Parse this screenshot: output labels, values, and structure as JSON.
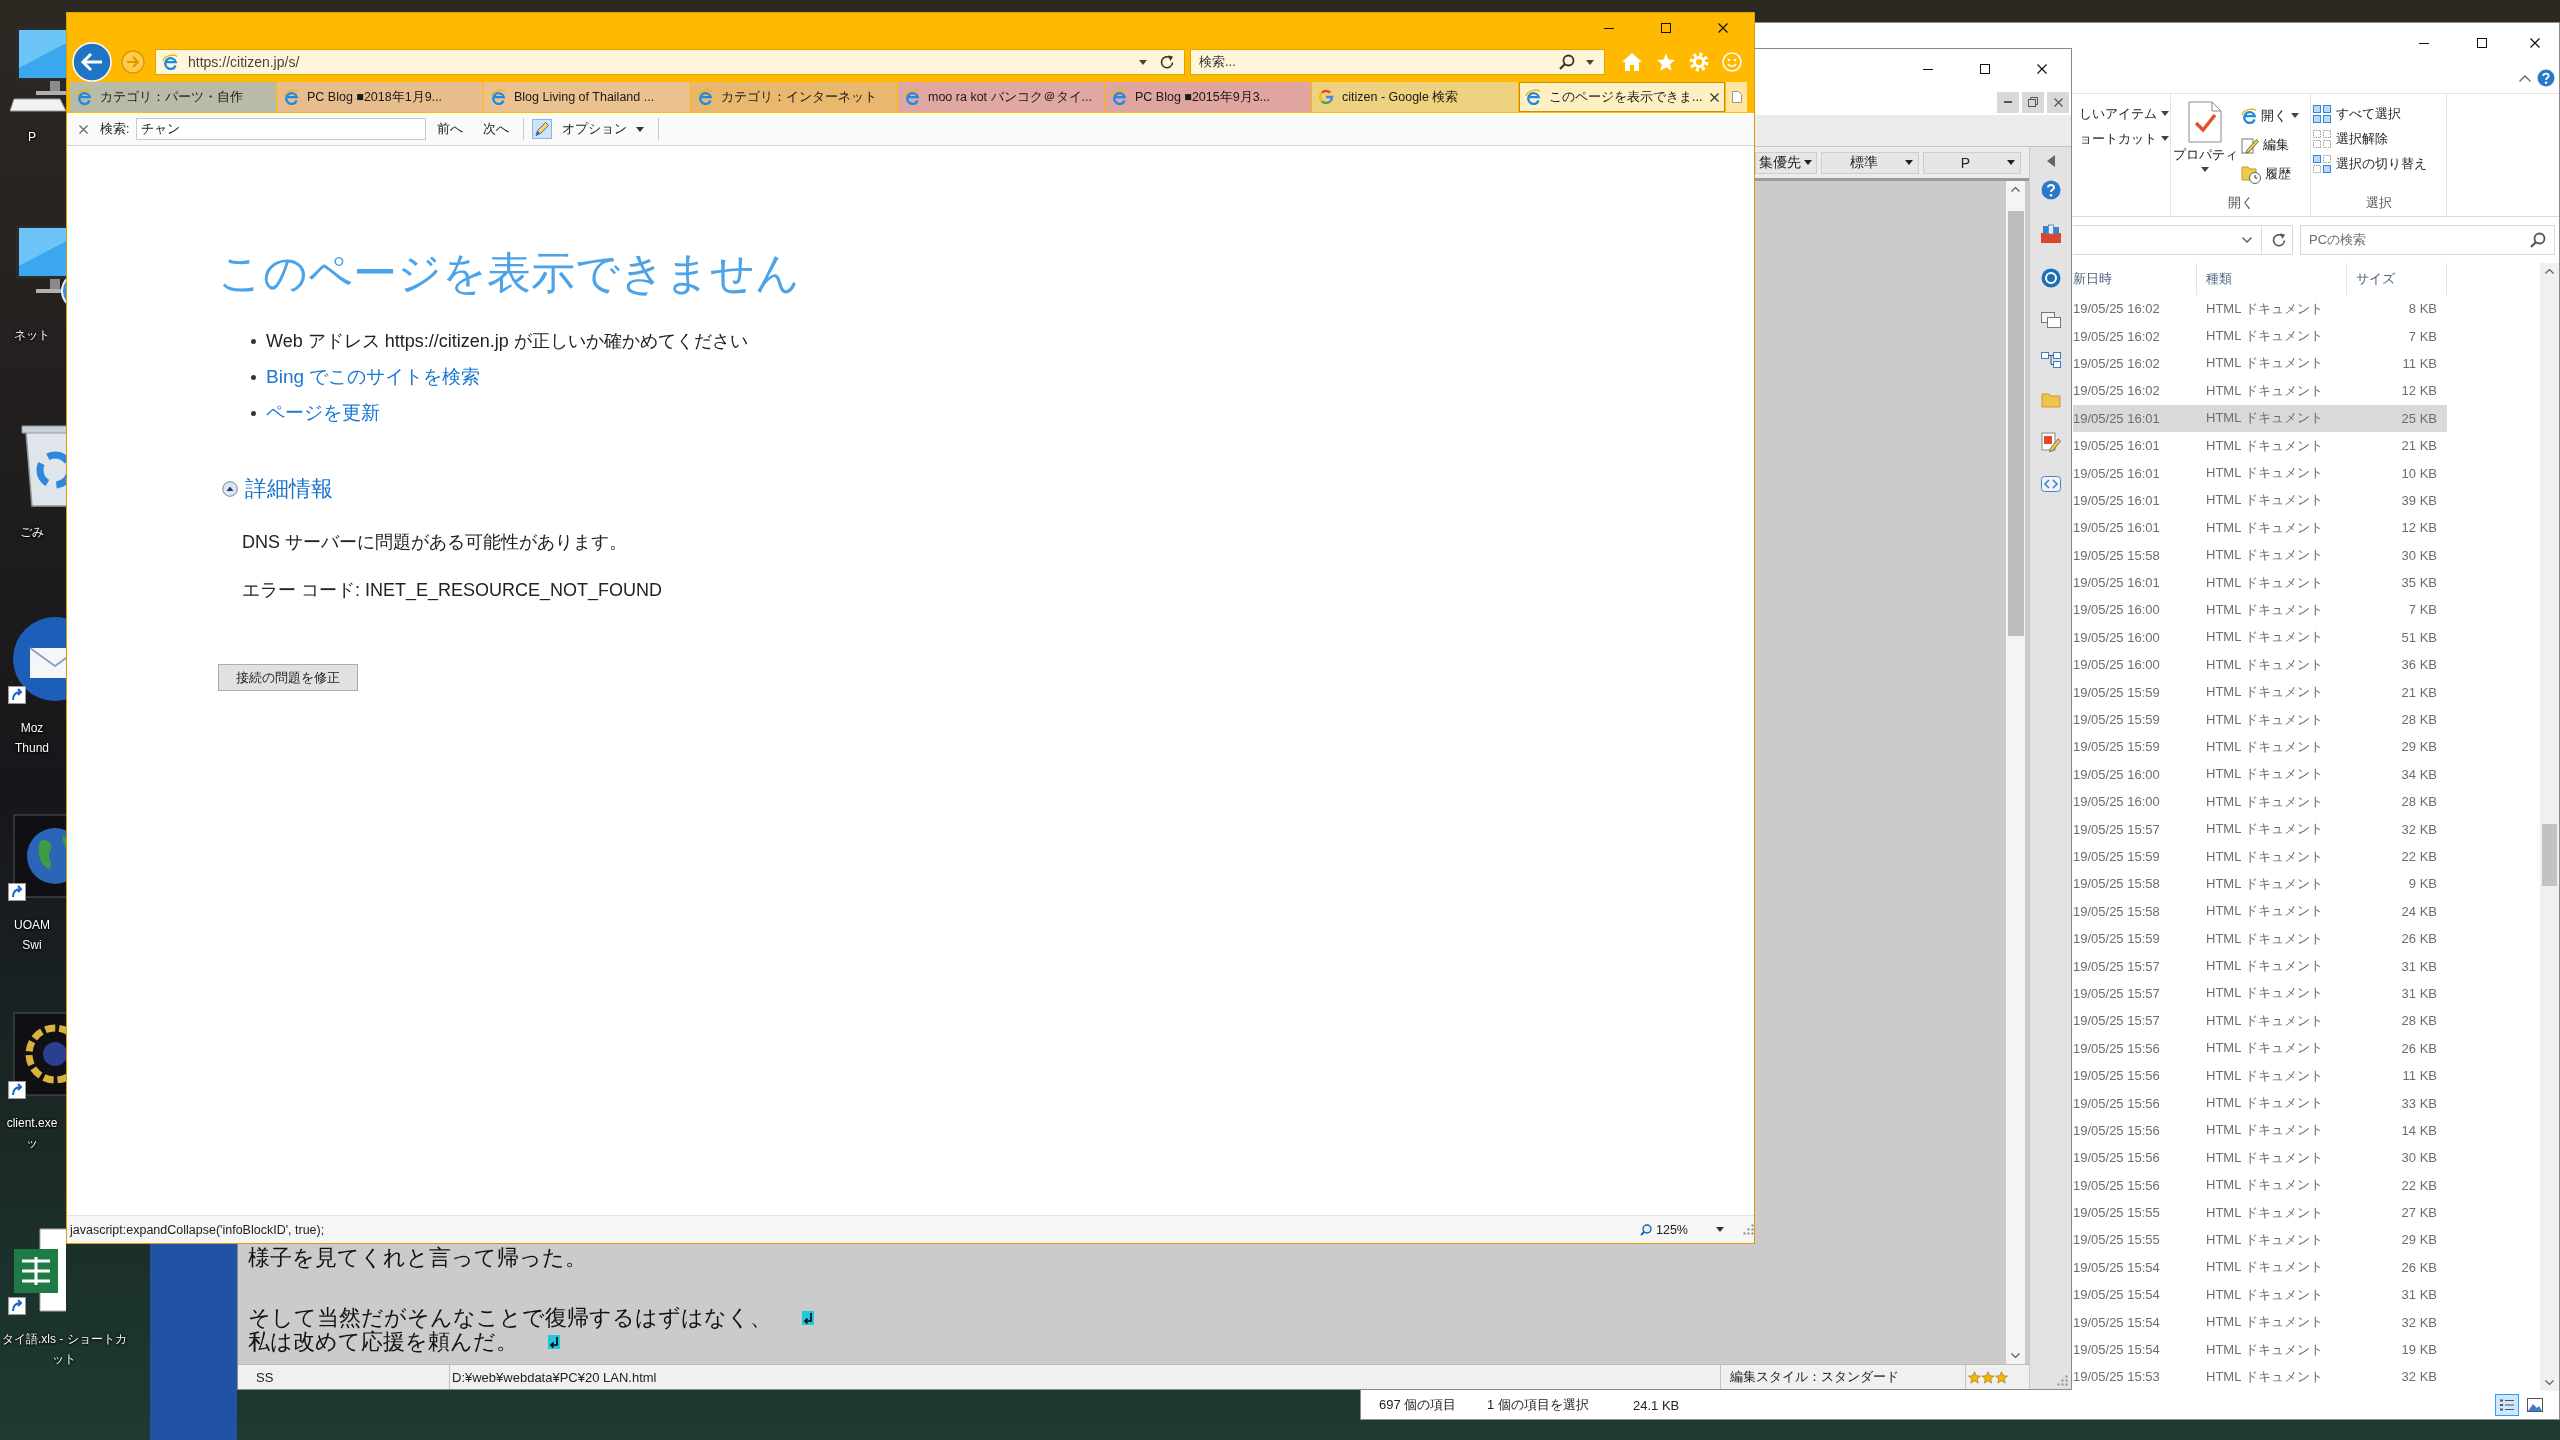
{
  "desktop": {
    "icons": [
      {
        "kind": "pc",
        "label": [
          "P"
        ],
        "shortcut": false
      },
      {
        "kind": "network",
        "label": [
          "ネット"
        ],
        "shortcut": false
      },
      {
        "kind": "trash",
        "label": [
          "ごみ"
        ],
        "shortcut": false
      },
      {
        "kind": "mail",
        "label": [
          "Moz",
          "Thund"
        ],
        "shortcut": true
      },
      {
        "kind": "globe",
        "label": [
          "UOAM",
          "Swi"
        ],
        "shortcut": true
      },
      {
        "kind": "ring",
        "label": [
          "client.exe",
          "ッ"
        ],
        "shortcut": true
      },
      {
        "kind": "sheet",
        "label": [
          "タイ語.xls - ショートカ",
          "ット"
        ],
        "shortcut": true
      }
    ]
  },
  "browser": {
    "address": "https://citizen.jp/s/",
    "search": {
      "placeholder": "検索..."
    },
    "tabs": [
      {
        "label": "カテゴリ：パーツ・自作",
        "kind": "page",
        "color": "#b8bca7",
        "selected": false
      },
      {
        "label": "PC Blog ■2018年1月9...",
        "kind": "page",
        "color": "#e8bd8e",
        "selected": false
      },
      {
        "label": "Blog Living of Thailand ...",
        "kind": "page",
        "color": "#ebc28f",
        "selected": false
      },
      {
        "label": "カテゴリ：インターネット",
        "kind": "page",
        "color": "#e9b86e",
        "selected": false
      },
      {
        "label": "moo ra kot バンコク＠タイ...",
        "kind": "page",
        "color": "#e1a8a1",
        "selected": false
      },
      {
        "label": "PC Blog ■2015年9月3...",
        "kind": "page",
        "color": "#dfa59e",
        "selected": false
      },
      {
        "label": "citizen - Google 検索",
        "kind": "search",
        "color": "#eed27f",
        "selected": false
      },
      {
        "label": "このページを表示できま...",
        "kind": "page",
        "color": "#fff0c4",
        "selected": true
      }
    ],
    "find_bar": {
      "label": "検索:",
      "value": "チャン",
      "previous": "前へ",
      "next": "次へ",
      "options": "オプション"
    },
    "page": {
      "title": "このページを表示できません",
      "bullets": [
        {
          "kind": "text",
          "text": "Web アドレス https://citizen.jp が正しいか確かめてください"
        },
        {
          "kind": "link",
          "text": "Bing でこのサイトを検索"
        },
        {
          "kind": "link",
          "text": "ページを更新"
        }
      ],
      "details": {
        "label": "詳細情報",
        "expanded": true,
        "lines": [
          "DNS サーバーに問題がある可能性があります。",
          "エラー コード: INET_E_RESOURCE_NOT_FOUND"
        ]
      },
      "fix_button": "接続の問題を修正"
    },
    "status_bar": {
      "link": "javascript:expandCollapse('infoBlockID', true);",
      "zoom": "125%"
    }
  },
  "editor": {
    "toolbar_dropdowns": [
      "集優先",
      "標準",
      "P"
    ],
    "paragraphs": [
      [
        {
          "text": "様子を見てくれと言って帰った。",
          "newline_mark": false
        }
      ],
      [
        {
          "text": "そして当然だがそんなことで復帰するはずはなく、",
          "newline_mark": true
        },
        {
          "text": "私は改めて応援を頼んだ。",
          "newline_mark": true
        }
      ]
    ],
    "status_bar": {
      "mode": "SS",
      "path": "D:¥web¥webdata¥PC¥20 LAN.html",
      "style": "編集スタイル：スタンダード"
    }
  },
  "explorer": {
    "ribbon": {
      "new_items": [
        {
          "label": "しいアイテム",
          "menu": true
        },
        {
          "label": "ョートカット",
          "menu": true
        }
      ],
      "open_group": {
        "label": "開く",
        "properties": {
          "label": "プロパティ",
          "menu": true
        },
        "items": [
          {
            "kind": "browser",
            "label": "開く",
            "menu": true
          },
          {
            "kind": "edit",
            "label": "編集",
            "menu": false
          },
          {
            "kind": "history",
            "label": "履歴",
            "menu": false
          }
        ]
      },
      "select_group": {
        "label": "選択",
        "items": [
          {
            "kind": "all",
            "label": "すべて選択"
          },
          {
            "kind": "none",
            "label": "選択解除"
          },
          {
            "kind": "invert",
            "label": "選択の切り替え"
          }
        ]
      }
    },
    "search": {
      "placeholder": "PCの検索"
    },
    "columns": [
      "新日時",
      "種類",
      "サイズ"
    ],
    "rows": [
      {
        "date": "19/05/25 16:02",
        "type": "HTML ドキュメント",
        "size": "8 KB",
        "selected": false
      },
      {
        "date": "19/05/25 16:02",
        "type": "HTML ドキュメント",
        "size": "7 KB",
        "selected": false
      },
      {
        "date": "19/05/25 16:02",
        "type": "HTML ドキュメント",
        "size": "11 KB",
        "selected": false
      },
      {
        "date": "19/05/25 16:02",
        "type": "HTML ドキュメント",
        "size": "12 KB",
        "selected": false
      },
      {
        "date": "19/05/25 16:01",
        "type": "HTML ドキュメント",
        "size": "25 KB",
        "selected": true
      },
      {
        "date": "19/05/25 16:01",
        "type": "HTML ドキュメント",
        "size": "21 KB",
        "selected": false
      },
      {
        "date": "19/05/25 16:01",
        "type": "HTML ドキュメント",
        "size": "10 KB",
        "selected": false
      },
      {
        "date": "19/05/25 16:01",
        "type": "HTML ドキュメント",
        "size": "39 KB",
        "selected": false
      },
      {
        "date": "19/05/25 16:01",
        "type": "HTML ドキュメント",
        "size": "12 KB",
        "selected": false
      },
      {
        "date": "19/05/25 15:58",
        "type": "HTML ドキュメント",
        "size": "30 KB",
        "selected": false
      },
      {
        "date": "19/05/25 16:01",
        "type": "HTML ドキュメント",
        "size": "35 KB",
        "selected": false
      },
      {
        "date": "19/05/25 16:00",
        "type": "HTML ドキュメント",
        "size": "7 KB",
        "selected": false
      },
      {
        "date": "19/05/25 16:00",
        "type": "HTML ドキュメント",
        "size": "51 KB",
        "selected": false
      },
      {
        "date": "19/05/25 16:00",
        "type": "HTML ドキュメント",
        "size": "36 KB",
        "selected": false
      },
      {
        "date": "19/05/25 15:59",
        "type": "HTML ドキュメント",
        "size": "21 KB",
        "selected": false
      },
      {
        "date": "19/05/25 15:59",
        "type": "HTML ドキュメント",
        "size": "28 KB",
        "selected": false
      },
      {
        "date": "19/05/25 15:59",
        "type": "HTML ドキュメント",
        "size": "29 KB",
        "selected": false
      },
      {
        "date": "19/05/25 16:00",
        "type": "HTML ドキュメント",
        "size": "34 KB",
        "selected": false
      },
      {
        "date": "19/05/25 16:00",
        "type": "HTML ドキュメント",
        "size": "28 KB",
        "selected": false
      },
      {
        "date": "19/05/25 15:57",
        "type": "HTML ドキュメント",
        "size": "32 KB",
        "selected": false
      },
      {
        "date": "19/05/25 15:59",
        "type": "HTML ドキュメント",
        "size": "22 KB",
        "selected": false
      },
      {
        "date": "19/05/25 15:58",
        "type": "HTML ドキュメント",
        "size": "9 KB",
        "selected": false
      },
      {
        "date": "19/05/25 15:58",
        "type": "HTML ドキュメント",
        "size": "24 KB",
        "selected": false
      },
      {
        "date": "19/05/25 15:59",
        "type": "HTML ドキュメント",
        "size": "26 KB",
        "selected": false
      },
      {
        "date": "19/05/25 15:57",
        "type": "HTML ドキュメント",
        "size": "31 KB",
        "selected": false
      },
      {
        "date": "19/05/25 15:57",
        "type": "HTML ドキュメント",
        "size": "31 KB",
        "selected": false
      },
      {
        "date": "19/05/25 15:57",
        "type": "HTML ドキュメント",
        "size": "28 KB",
        "selected": false
      },
      {
        "date": "19/05/25 15:56",
        "type": "HTML ドキュメント",
        "size": "26 KB",
        "selected": false
      },
      {
        "date": "19/05/25 15:56",
        "type": "HTML ドキュメント",
        "size": "11 KB",
        "selected": false
      },
      {
        "date": "19/05/25 15:56",
        "type": "HTML ドキュメント",
        "size": "33 KB",
        "selected": false
      },
      {
        "date": "19/05/25 15:56",
        "type": "HTML ドキュメント",
        "size": "14 KB",
        "selected": false
      },
      {
        "date": "19/05/25 15:56",
        "type": "HTML ドキュメント",
        "size": "30 KB",
        "selected": false
      },
      {
        "date": "19/05/25 15:56",
        "type": "HTML ドキュメント",
        "size": "22 KB",
        "selected": false
      },
      {
        "date": "19/05/25 15:55",
        "type": "HTML ドキュメント",
        "size": "27 KB",
        "selected": false
      },
      {
        "date": "19/05/25 15:55",
        "type": "HTML ドキュメント",
        "size": "29 KB",
        "selected": false
      },
      {
        "date": "19/05/25 15:54",
        "type": "HTML ドキュメント",
        "size": "26 KB",
        "selected": false
      },
      {
        "date": "19/05/25 15:54",
        "type": "HTML ドキュメント",
        "size": "31 KB",
        "selected": false
      },
      {
        "date": "19/05/25 15:54",
        "type": "HTML ドキュメント",
        "size": "32 KB",
        "selected": false
      },
      {
        "date": "19/05/25 15:54",
        "type": "HTML ドキュメント",
        "size": "19 KB",
        "selected": false
      },
      {
        "date": "19/05/25 15:53",
        "type": "HTML ドキュメント",
        "size": "32 KB",
        "selected": false
      }
    ],
    "status_bar": {
      "count": "697 個の項目",
      "selection": "1 個の項目を選択",
      "selection_size": "24.1 KB"
    },
    "views": [
      {
        "kind": "details",
        "selected": true
      },
      {
        "kind": "tiles",
        "selected": false
      }
    ]
  }
}
